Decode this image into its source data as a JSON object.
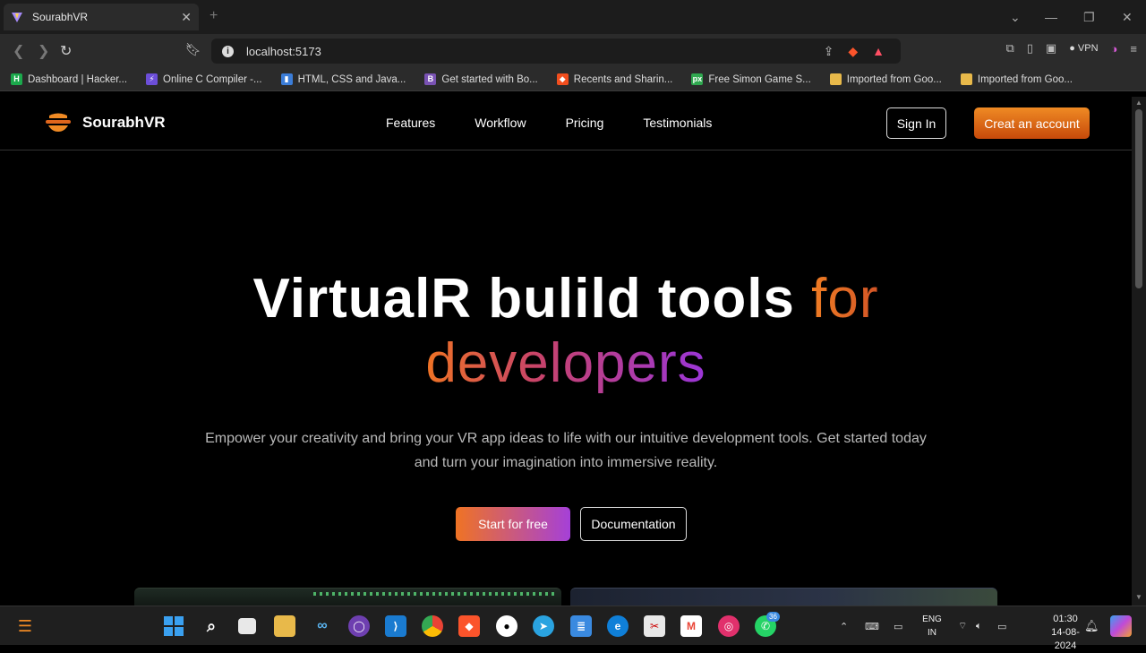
{
  "browser": {
    "tab_title": "SourabhVR",
    "tab_close": "✕",
    "new_tab": "+",
    "url": "localhost:5173",
    "vpn_label": "VPN",
    "bookmarks": [
      {
        "label": "Dashboard | Hacker...",
        "icon": "hackerrank-icon",
        "color": "#1ba94c",
        "glyph": "H"
      },
      {
        "label": "Online C Compiler -...",
        "icon": "compiler-icon",
        "color": "#6c4ed8",
        "glyph": "⚡"
      },
      {
        "label": "HTML, CSS and Java...",
        "icon": "chart-icon",
        "color": "#3b7dd8",
        "glyph": "▮"
      },
      {
        "label": "Get started with Bo...",
        "icon": "bootstrap-icon",
        "color": "#7952b3",
        "glyph": "B"
      },
      {
        "label": "Recents and Sharin...",
        "icon": "figma-icon",
        "color": "#f24e1e",
        "glyph": "◆"
      },
      {
        "label": "Free Simon Game S...",
        "icon": "px-icon",
        "color": "#2fa84f",
        "glyph": "px"
      },
      {
        "label": "Imported from Goo...",
        "icon": "folder-icon",
        "color": "#e8b94a",
        "glyph": ""
      },
      {
        "label": "Imported from Goo...",
        "icon": "folder-icon",
        "color": "#e8b94a",
        "glyph": ""
      }
    ]
  },
  "site": {
    "brand": "SourabhVR",
    "nav_links": [
      "Features",
      "Workflow",
      "Pricing",
      "Testimonials"
    ],
    "sign_in": "Sign In",
    "create_account": "Creat an account",
    "hero_line1_main": "VirtualR bulild tools",
    "hero_line1_accent": "for",
    "hero_line2": "developers",
    "subtitle": "Empower your creativity and bring your VR app ideas to life with our intuitive development tools. Get started today and turn your imagination into immersive reality.",
    "start_button": "Start for free",
    "docs_button": "Documentation"
  },
  "taskbar": {
    "lang_top": "ENG",
    "lang_bottom": "IN",
    "time": "01:30",
    "date": "14-08-2024",
    "whatsapp_badge": "36"
  },
  "colors": {
    "accent_orange": "#ef7d24",
    "accent_purple": "#9a35d8"
  }
}
